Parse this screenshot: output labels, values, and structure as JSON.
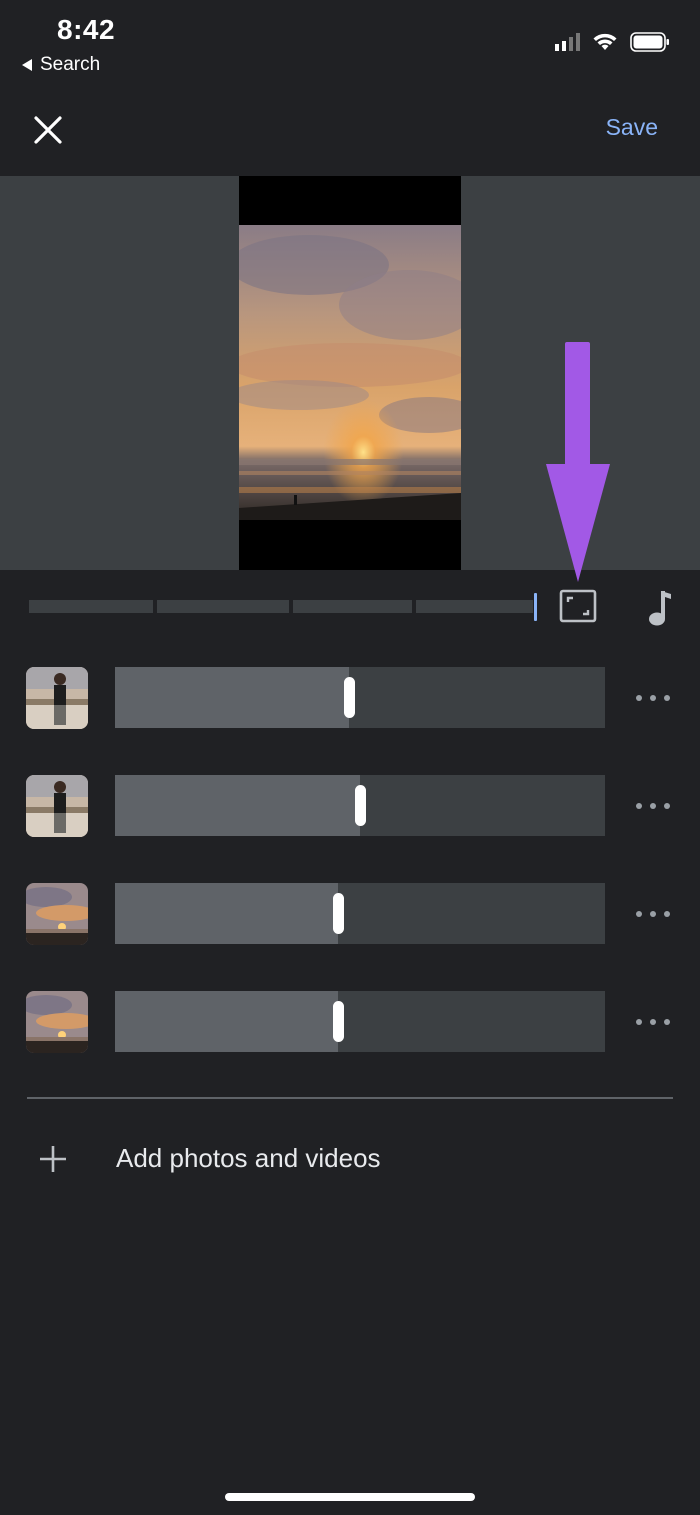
{
  "status_bar": {
    "time": "8:42",
    "back_label": "Search"
  },
  "top_bar": {
    "save_label": "Save"
  },
  "clips": [
    {
      "thumbnail": "person-on-beach-photo",
      "trim_position": 0.477
    },
    {
      "thumbnail": "person-on-beach-photo",
      "trim_position": 0.5
    },
    {
      "thumbnail": "sunset-photo",
      "trim_position": 0.455
    },
    {
      "thumbnail": "sunset-photo",
      "trim_position": 0.455
    }
  ],
  "add_media": {
    "label": "Add photos and videos"
  },
  "colors": {
    "accent": "#8ab4f8",
    "background": "#202124",
    "annotation_arrow": "#a259e6"
  },
  "icons": [
    "close-icon",
    "aspect-ratio-icon",
    "music-note-icon",
    "more-options-icon",
    "plus-icon"
  ]
}
